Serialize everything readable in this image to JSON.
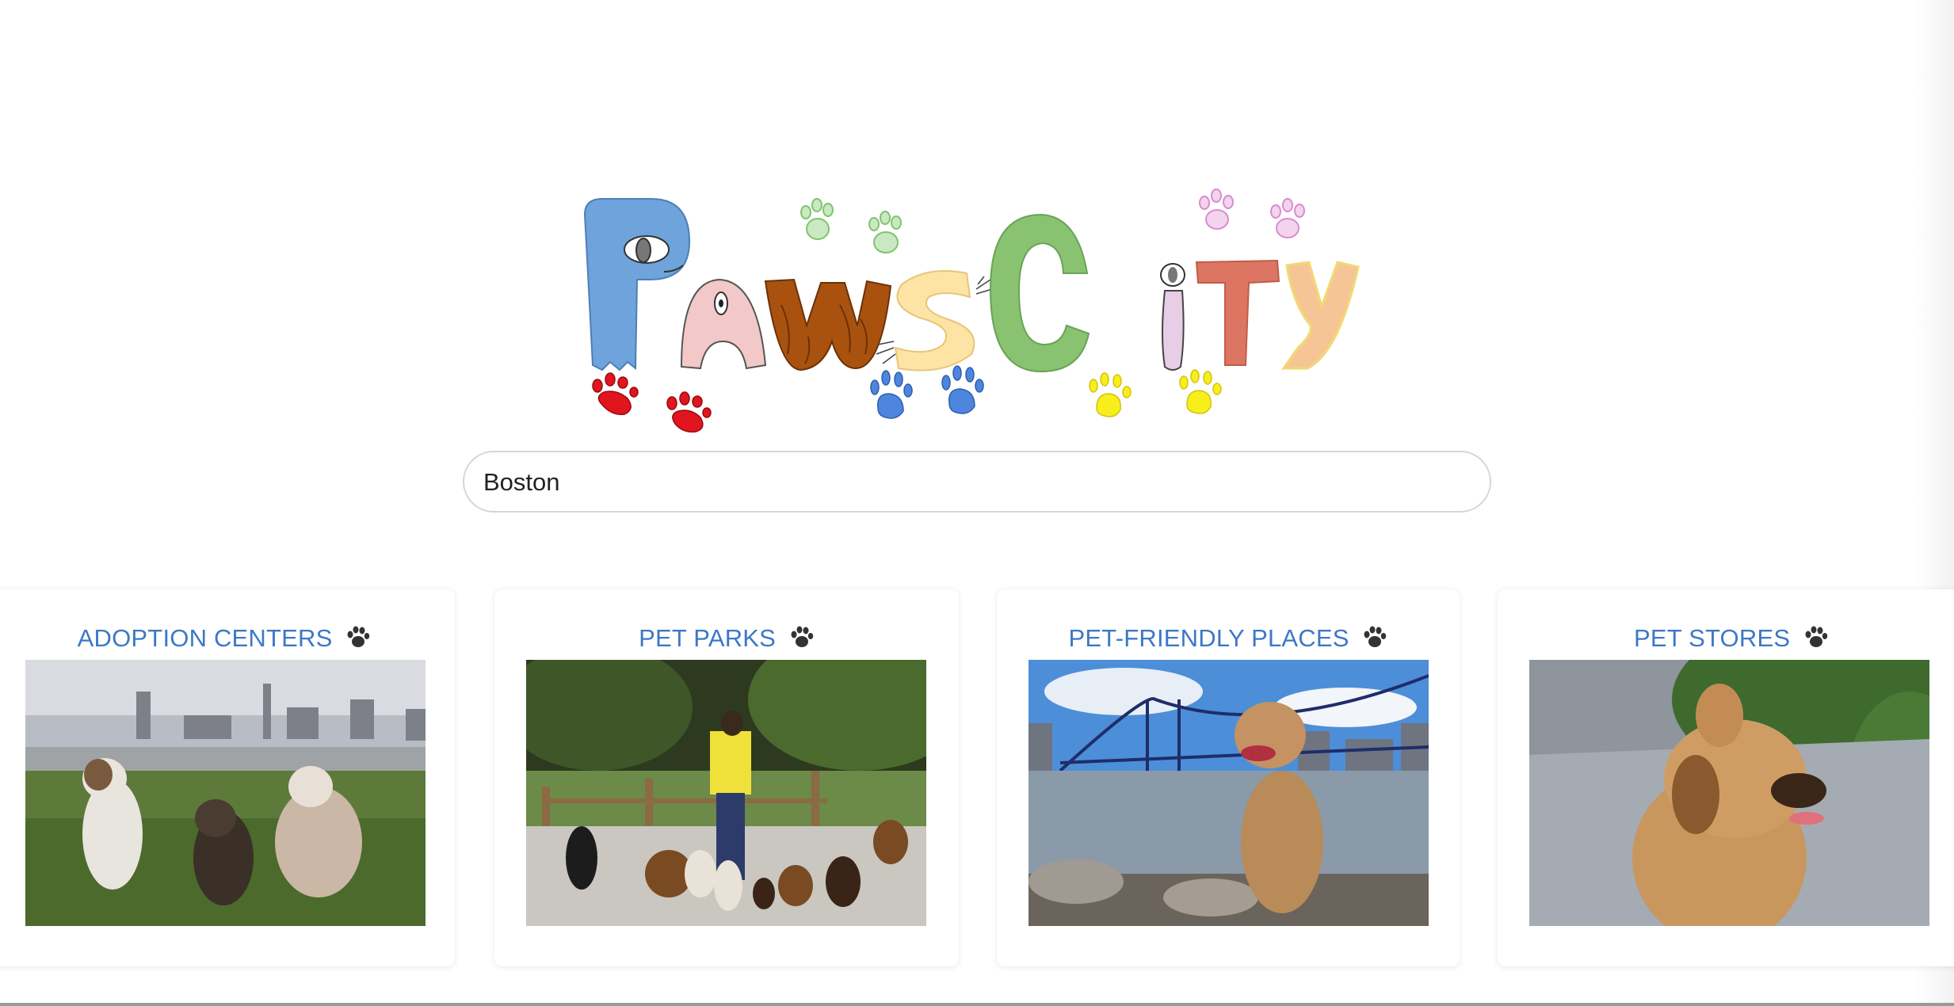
{
  "app": {
    "name": "Paws City"
  },
  "logo": {
    "alt": "Paws City"
  },
  "search": {
    "value": "Boston",
    "placeholder": ""
  },
  "categories": [
    {
      "label": "ADOPTION CENTERS",
      "icon": "paw-icon",
      "image": "dogs-by-river-photo"
    },
    {
      "label": "PET PARKS",
      "icon": "paw-icon",
      "image": "dog-walker-photo"
    },
    {
      "label": "PET-FRIENDLY PLACES",
      "icon": "paw-icon",
      "image": "dog-by-bridge-photo"
    },
    {
      "label": "PET STORES",
      "icon": "paw-icon",
      "image": "pug-mix-photo"
    }
  ],
  "colors": {
    "link": "#3d78c6",
    "logo_p": "#6ea3dc",
    "logo_a": "#f2c8c8",
    "logo_w": "#a9520f",
    "logo_s": "#fde3a4",
    "logo_c": "#89c270",
    "logo_i": "#e8cde6",
    "logo_t": "#dc7662",
    "logo_y": "#f6c596"
  }
}
